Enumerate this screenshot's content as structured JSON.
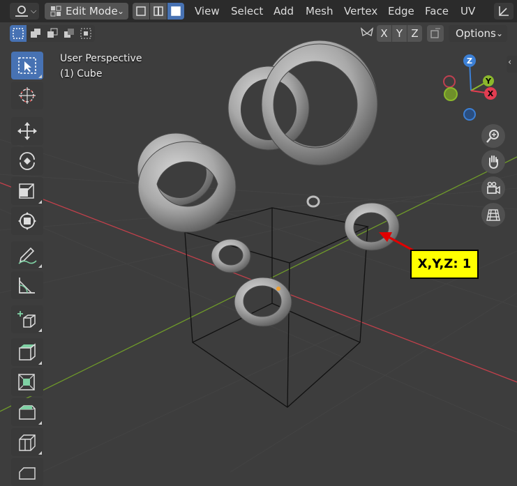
{
  "header": {
    "mode": "Edit Mode",
    "menus": [
      "View",
      "Select",
      "Add",
      "Mesh",
      "Vertex",
      "Edge",
      "Face",
      "UV"
    ]
  },
  "axis_buttons": {
    "x": "X",
    "y": "Y",
    "z": "Z"
  },
  "options_label": "Options",
  "viewport": {
    "view_name": "User Perspective",
    "object_name": "(1) Cube"
  },
  "gizmo": {
    "z": "Z",
    "y": "Y",
    "x": "X"
  },
  "callout": {
    "text": "X,Y,Z: 1",
    "color": "#ffff00",
    "arrow_color": "#e00000"
  },
  "colors": {
    "accent": "#4772b3",
    "x_axis": "#e23d51",
    "y_axis": "#8bb82c",
    "z_axis": "#3c80d6",
    "viewport_bg": "#3d3d3d"
  },
  "toolbar_icons": [
    "select-box-icon",
    "cursor-icon",
    "move-icon",
    "rotate-icon",
    "scale-icon",
    "transform-icon",
    "annotate-icon",
    "measure-icon",
    "add-cube-icon",
    "extrude-icon",
    "inset-icon",
    "bevel-icon",
    "loop-cut-icon",
    "knife-icon"
  ],
  "nav_icons": [
    "zoom-icon",
    "pan-hand-icon",
    "camera-icon",
    "grid-ortho-icon"
  ]
}
